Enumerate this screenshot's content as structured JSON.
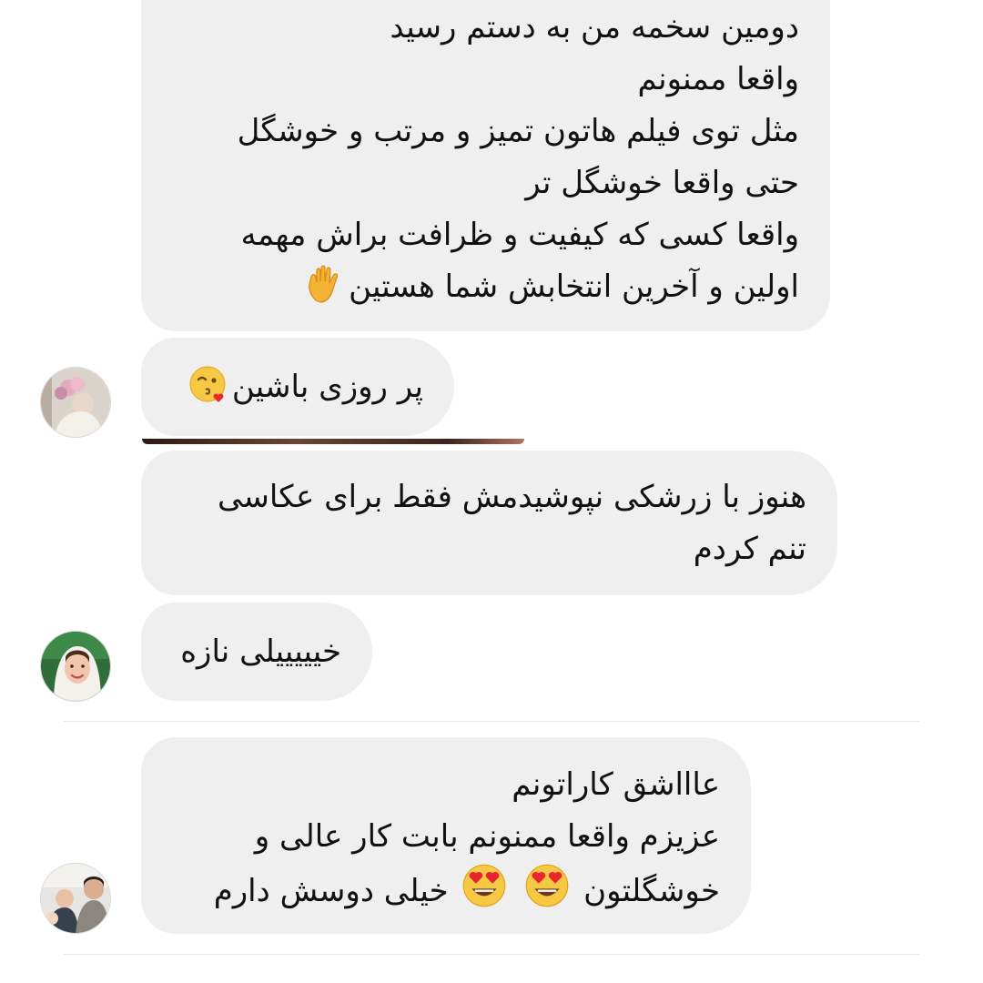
{
  "messages": [
    {
      "lines": [
        "دومین سخمه من به دستم رسید",
        "واقعا ممنونم",
        "مثل توی فیلم هاتون تمیز و مرتب و خوشگل",
        "حتی واقعا خوشگل تر",
        "واقعا کسی که کیفیت و ظرافت براش مهمه",
        "اولین و آخرین انتخابش شما هستین"
      ],
      "emoji": "raised-hand"
    },
    {
      "lines": [
        "پر روزی باشین"
      ],
      "emoji": "kissing-heart"
    },
    {
      "lines": [
        "هنوز با زرشکی نپوشیدمش فقط برای عکاسی",
        "تنم کردم"
      ]
    },
    {
      "lines": [
        "خیییییلی نازه"
      ]
    },
    {
      "lines": [
        "عاااشق کاراتونم",
        "عزیزم واقعا ممنونم بابت کار عالی و",
        "خیلی دوسش دارم",
        "خوشگلتون"
      ],
      "emoji": "heart-eyes"
    }
  ],
  "colors": {
    "bubble": "#efefef",
    "text": "#111111",
    "divider": "#e6e6e6"
  }
}
